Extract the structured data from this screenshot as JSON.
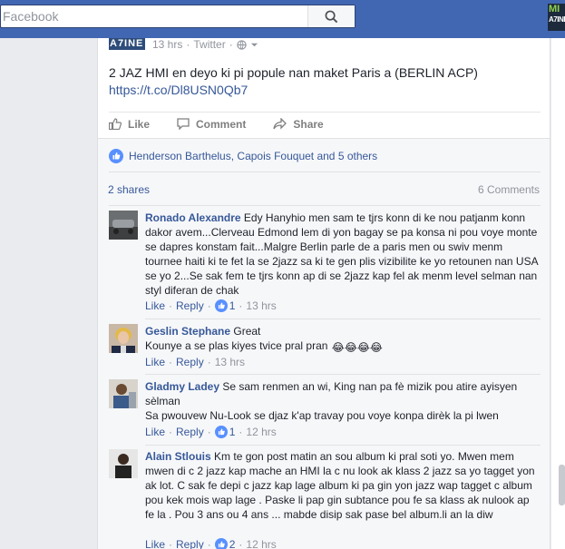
{
  "search": {
    "placeholder": "Facebook"
  },
  "brand": {
    "line1": "MI",
    "line2": "A7INE"
  },
  "post": {
    "source_logo": "A7INE",
    "time": "13 hrs",
    "via": "Twitter",
    "text": "2 JAZ HMI en deyo ki pi popule nan maket Paris a (BERLIN ACP)",
    "link": "https://t.co/Dl8USN0Qb7"
  },
  "actions": {
    "like": "Like",
    "comment": "Comment",
    "share": "Share"
  },
  "likers": "Henderson Barthelus, Capois Fouquet and 5 others",
  "shares": "2 shares",
  "comments_count": "6 Comments",
  "comments": [
    {
      "author": "Ronado Alexandre",
      "text": "Edy Hanyhio men sam te tjrs konn di ke nou patjanm konn dakor avem...Clerveau Edmond lem di yon bagay se pa konsa ni pou voye monte se dapres konstam fait...Malgre Berlin parle de a paris men ou swiv menm tournee haiti ki te fet la se 2jazz sa ki te gen plis vizibilite ke yo retounen nan USA se yo 2...Se sak fem te tjrs konn ap di se 2jazz kap fel ak menm level selman nan styl diferan de chak",
      "like": "Like",
      "reply": "Reply",
      "likes": "1",
      "time": "13 hrs"
    },
    {
      "author": "Geslin Stephane",
      "text": "Great",
      "text2": "Kounye a se plas kiyes tvice pral pran",
      "emojis": "😂😂😂😂",
      "like": "Like",
      "reply": "Reply",
      "time": "13 hrs"
    },
    {
      "author": "Gladmy Ladey",
      "text": "Se sam renmen an wi, King nan pa fè mizik pou atire ayisyen sèlman",
      "text2": "Sa pwouvew Nu-Look se djaz k'ap travay pou voye konpa dirèk la pi lwen",
      "like": "Like",
      "reply": "Reply",
      "likes": "1",
      "time": "12 hrs"
    },
    {
      "author": "Alain Stlouis",
      "text": "Km te gon post matin an sou album ki pral soti yo. Mwen mem mwen di c 2 jazz kap mache an HMI la c nu look ak klass 2 jazz sa yo tagget yon ak lot. C sak fe depi c jazz kap lage album ki pa gin yon jazz wap tagget c album pou kek mois wap lage . Paske li pap gin subtance pou fe sa klass ak nulook ap fe la . Pou 3 ans ou 4 ans ... mabde disip sak pase bel album.li an la diw",
      "like": "Like",
      "reply": "Reply",
      "likes": "2",
      "time": "12 hrs"
    }
  ],
  "colors": {
    "facebook_blue": "#4267b2",
    "link": "#365899",
    "meta_gray": "#90949c",
    "feedback_bg": "#f6f7f9"
  }
}
